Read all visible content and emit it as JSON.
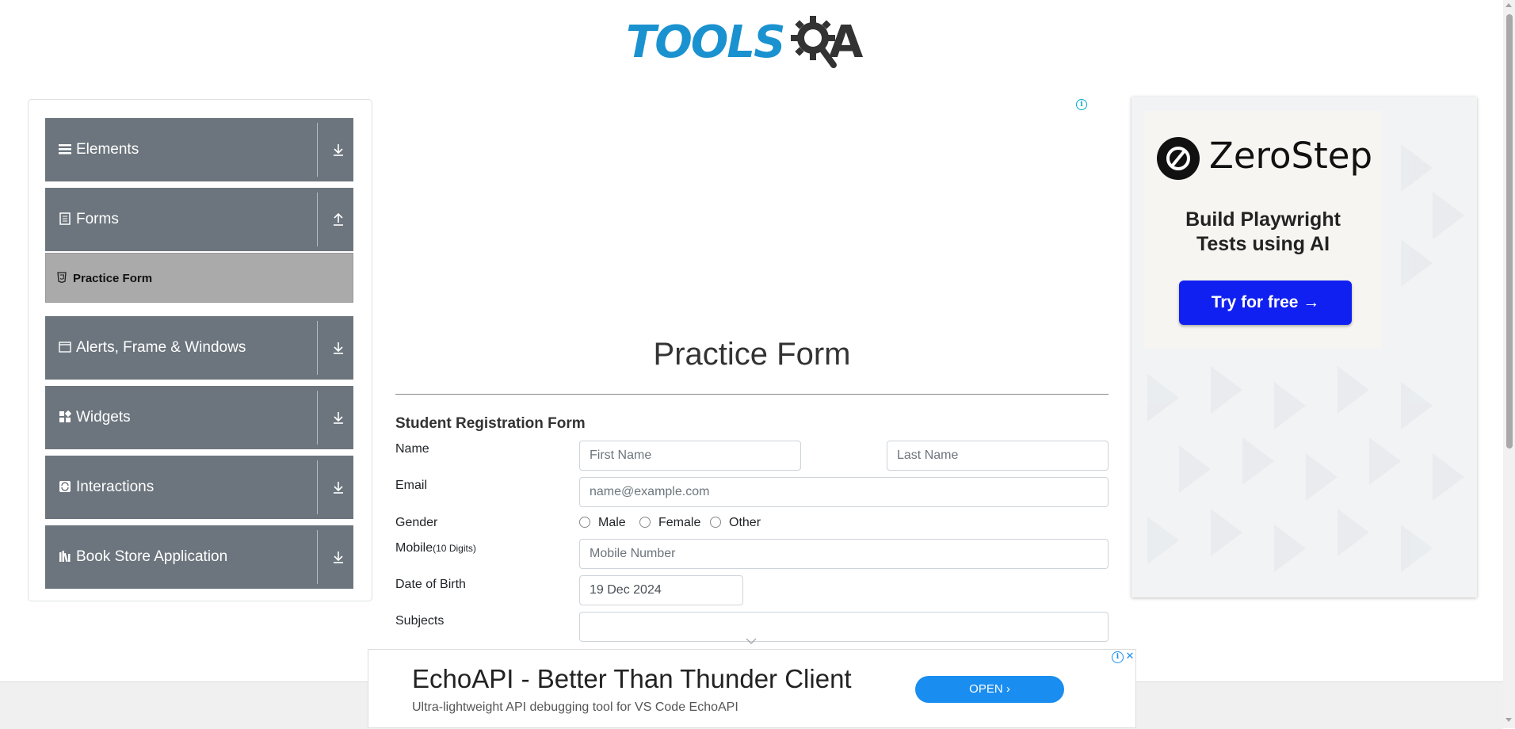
{
  "logo": {
    "part1": "TOOLS",
    "part2": "A"
  },
  "sidebar": {
    "groups": [
      {
        "label": "Elements",
        "icon": "menu-lines-icon",
        "arrow": "download-arrow"
      },
      {
        "label": "Forms",
        "icon": "document-icon",
        "arrow": "upload-arrow"
      },
      {
        "label": "Alerts, Frame & Windows",
        "icon": "window-icon",
        "arrow": "download-arrow"
      },
      {
        "label": "Widgets",
        "icon": "grid-widgets-icon",
        "arrow": "download-arrow"
      },
      {
        "label": "Interactions",
        "icon": "interaction-icon",
        "arrow": "download-arrow"
      },
      {
        "label": "Book Store Application",
        "icon": "books-icon",
        "arrow": "download-arrow"
      }
    ],
    "active_item": {
      "label": "Practice Form",
      "icon": "html5-icon"
    }
  },
  "main": {
    "ad_info": "i",
    "title": "Practice Form",
    "form_title": "Student Registration Form",
    "labels": {
      "name": "Name",
      "email": "Email",
      "gender": "Gender",
      "mobile": "Mobile",
      "mobile_hint": "(10 Digits)",
      "dob": "Date of Birth",
      "subjects": "Subjects"
    },
    "placeholders": {
      "first_name": "First Name",
      "last_name": "Last Name",
      "email": "name@example.com",
      "mobile": "Mobile Number"
    },
    "values": {
      "dob": "19 Dec 2024",
      "subjects": ""
    },
    "gender_options": [
      "Male",
      "Female",
      "Other"
    ]
  },
  "right_ad": {
    "brand": "ZeroStep",
    "tagline_line1": "Build Playwright",
    "tagline_line2": "Tests using AI",
    "button": "Try for free →"
  },
  "bottom_ad": {
    "title": "EchoAPI - Better Than Thunder Client",
    "subtitle": "Ultra-lightweight API debugging tool for VS Code EchoAPI",
    "button": "OPEN",
    "info": "i",
    "close": "✕"
  },
  "colors": {
    "logo_blue": "#1a92d0",
    "sidebar_group": "#6c757d",
    "active_item": "#aaaaaa",
    "cta_blue": "#1020f0",
    "open_button": "#1a8df0"
  }
}
